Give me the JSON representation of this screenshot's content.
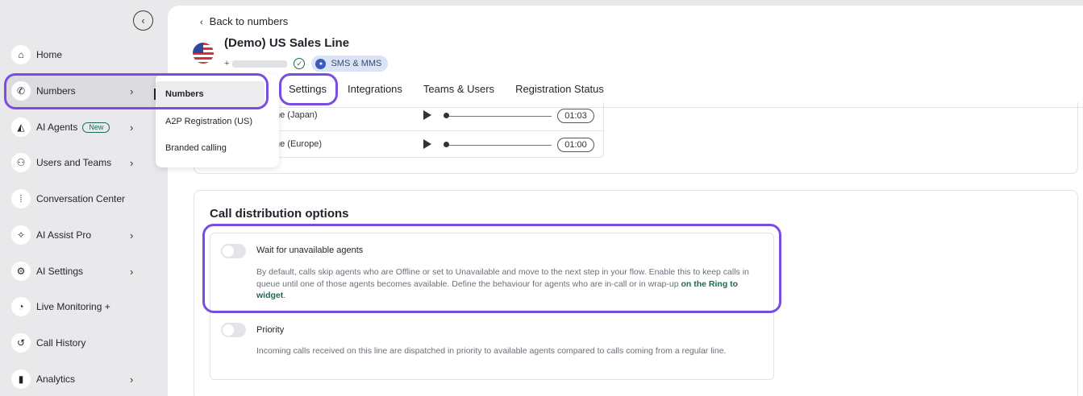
{
  "sidebar": {
    "collapse_icon": "chevron-left-icon",
    "items": [
      {
        "label": "Home",
        "icon": "home-icon"
      },
      {
        "label": "Numbers",
        "icon": "phone-icon"
      },
      {
        "label": "AI Agents",
        "icon": "ai-agent-icon",
        "badge": "New"
      },
      {
        "label": "Users and Teams",
        "icon": "users-icon"
      },
      {
        "label": "Conversation Center",
        "icon": "waveform-icon"
      },
      {
        "label": "AI Assist Pro",
        "icon": "ai-assist-icon"
      },
      {
        "label": "AI Settings",
        "icon": "gear-icon"
      },
      {
        "label": "Live Monitoring +",
        "icon": "monitoring-icon"
      },
      {
        "label": "Call History",
        "icon": "history-icon"
      },
      {
        "label": "Analytics",
        "icon": "analytics-icon"
      }
    ]
  },
  "submenu": {
    "items": [
      {
        "label": "Numbers"
      },
      {
        "label": "A2P Registration (US)"
      },
      {
        "label": "Branded calling"
      }
    ]
  },
  "header": {
    "back_label": "Back to numbers",
    "title": "(Demo) US Sales Line",
    "phone_prefix": "+",
    "badge": "SMS & MMS"
  },
  "tabs": [
    {
      "label": "Settings"
    },
    {
      "label": "Integrations"
    },
    {
      "label": "Teams & Users"
    },
    {
      "label": "Registration Status"
    }
  ],
  "audio_files": [
    {
      "name": "ne (Japan)",
      "duration": "01:03"
    },
    {
      "name": "ne (Europe)",
      "duration": "01:00"
    }
  ],
  "call_distribution": {
    "title": "Call distribution options",
    "wait_option": {
      "title": "Wait for unavailable agents",
      "description": "By default, calls skip agents who are Offline or set to Unavailable and move to the next step in your flow. Enable this to keep calls in queue until one of those agents becomes available. Define the behaviour for agents who are in-call or in wrap-up ",
      "link": "on the Ring to widget",
      "suffix": ".",
      "enabled": false
    },
    "priority_option": {
      "title": "Priority",
      "description": "Incoming calls received on this line are dispatched in priority to available agents compared to calls coming from a regular line.",
      "enabled": false
    }
  },
  "colors": {
    "highlight": "#7a4de0",
    "accent_green": "#1a6b54",
    "sidebar_bg": "#e9e9ec"
  }
}
